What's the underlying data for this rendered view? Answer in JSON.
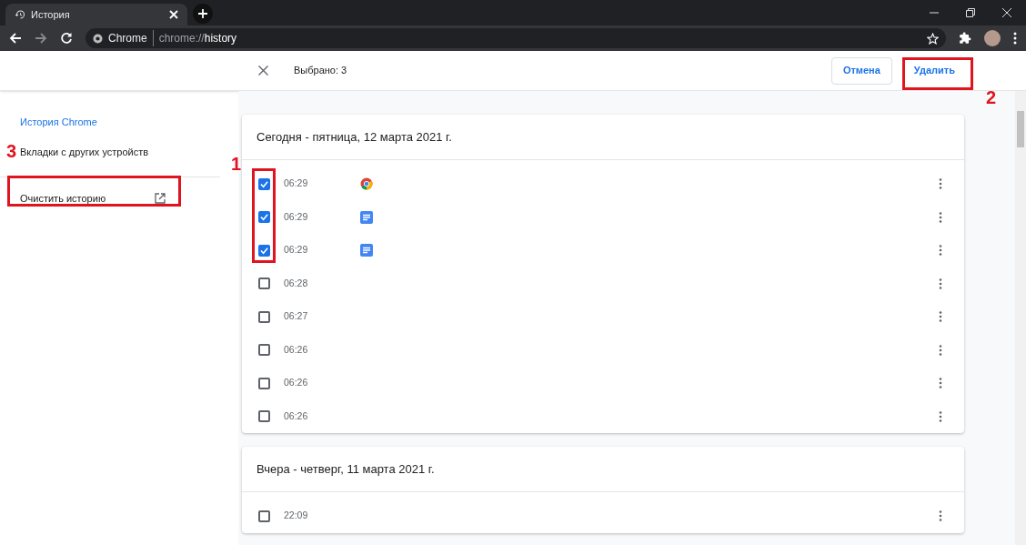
{
  "browser": {
    "tab": {
      "title": "История"
    },
    "omnibox": {
      "site": "Chrome",
      "url_prefix": "chrome://",
      "url_host": "history"
    }
  },
  "toolbar": {
    "selected_count": "Выбрано: 3",
    "buttons": [
      {
        "label": "Отмена",
        "kind": "secondary"
      },
      {
        "label": "Удалить",
        "kind": "primary"
      }
    ]
  },
  "sidebar": {
    "items": [
      {
        "label": "История Chrome",
        "selected": true
      },
      {
        "label": "Вкладки с других устройств",
        "selected": false
      }
    ],
    "clear": {
      "label": "Очистить историю"
    }
  },
  "groups": [
    {
      "title": "Сегодня - пятница, 12 марта 2021 г.",
      "rows": [
        {
          "time": "06:29",
          "checked": true,
          "kind": "chrome"
        },
        {
          "time": "06:29",
          "checked": true,
          "kind": "doc"
        },
        {
          "time": "06:29",
          "checked": true,
          "kind": "doc"
        },
        {
          "time": "06:28",
          "checked": false,
          "kind": "plain"
        },
        {
          "time": "06:27",
          "checked": false,
          "kind": "plain"
        },
        {
          "time": "06:26",
          "checked": false,
          "kind": "plain"
        },
        {
          "time": "06:26",
          "checked": false,
          "kind": "plain"
        },
        {
          "time": "06:26",
          "checked": false,
          "kind": "plain"
        }
      ]
    },
    {
      "title": "Вчера - четверг, 11 марта 2021 г.",
      "rows": [
        {
          "time": "22:09",
          "checked": false,
          "kind": "plain"
        }
      ]
    }
  ],
  "annotations": [
    {
      "label": "1"
    },
    {
      "label": "2"
    },
    {
      "label": "3"
    }
  ]
}
